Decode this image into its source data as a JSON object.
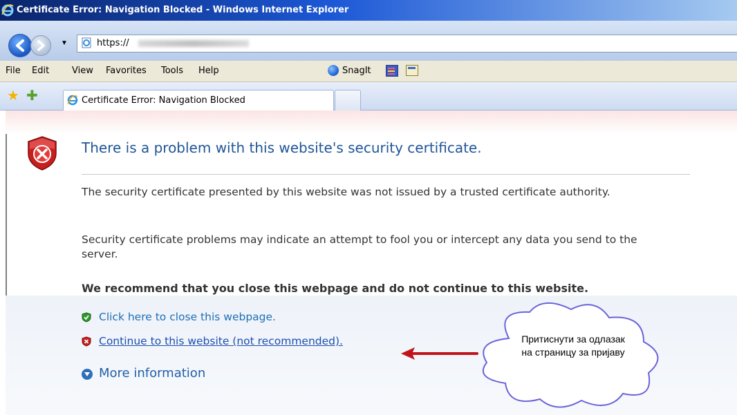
{
  "window": {
    "title": "Certificate Error: Navigation Blocked - Windows Internet Explorer"
  },
  "address_bar": {
    "url": "https://"
  },
  "menu": {
    "items": [
      "File",
      "Edit",
      "View",
      "Favorites",
      "Tools",
      "Help"
    ],
    "snagit_label": "SnagIt"
  },
  "tabs": [
    {
      "label": "Certificate Error: Navigation Blocked"
    }
  ],
  "content": {
    "headline": "There is a problem with this website's security certificate.",
    "paragraph1": "The security certificate presented by this website was not issued by a trusted certificate authority.",
    "paragraph2": "Security certificate problems may indicate an attempt to fool you or intercept any data you send to the server.",
    "recommendation": "We recommend that you close this webpage and do not continue to this website.",
    "close_link": "Click here to close this webpage.",
    "continue_link": "Continue to this website (not recommended).",
    "more_info": "More information"
  },
  "annotation": {
    "line1": "Притиснути за одлазак",
    "line2": "на страницу за пријаву"
  },
  "colors": {
    "headline": "#1f5597",
    "link": "#1f6fb5",
    "arrow": "#c0141a",
    "cloud_stroke": "#6a63d8"
  }
}
